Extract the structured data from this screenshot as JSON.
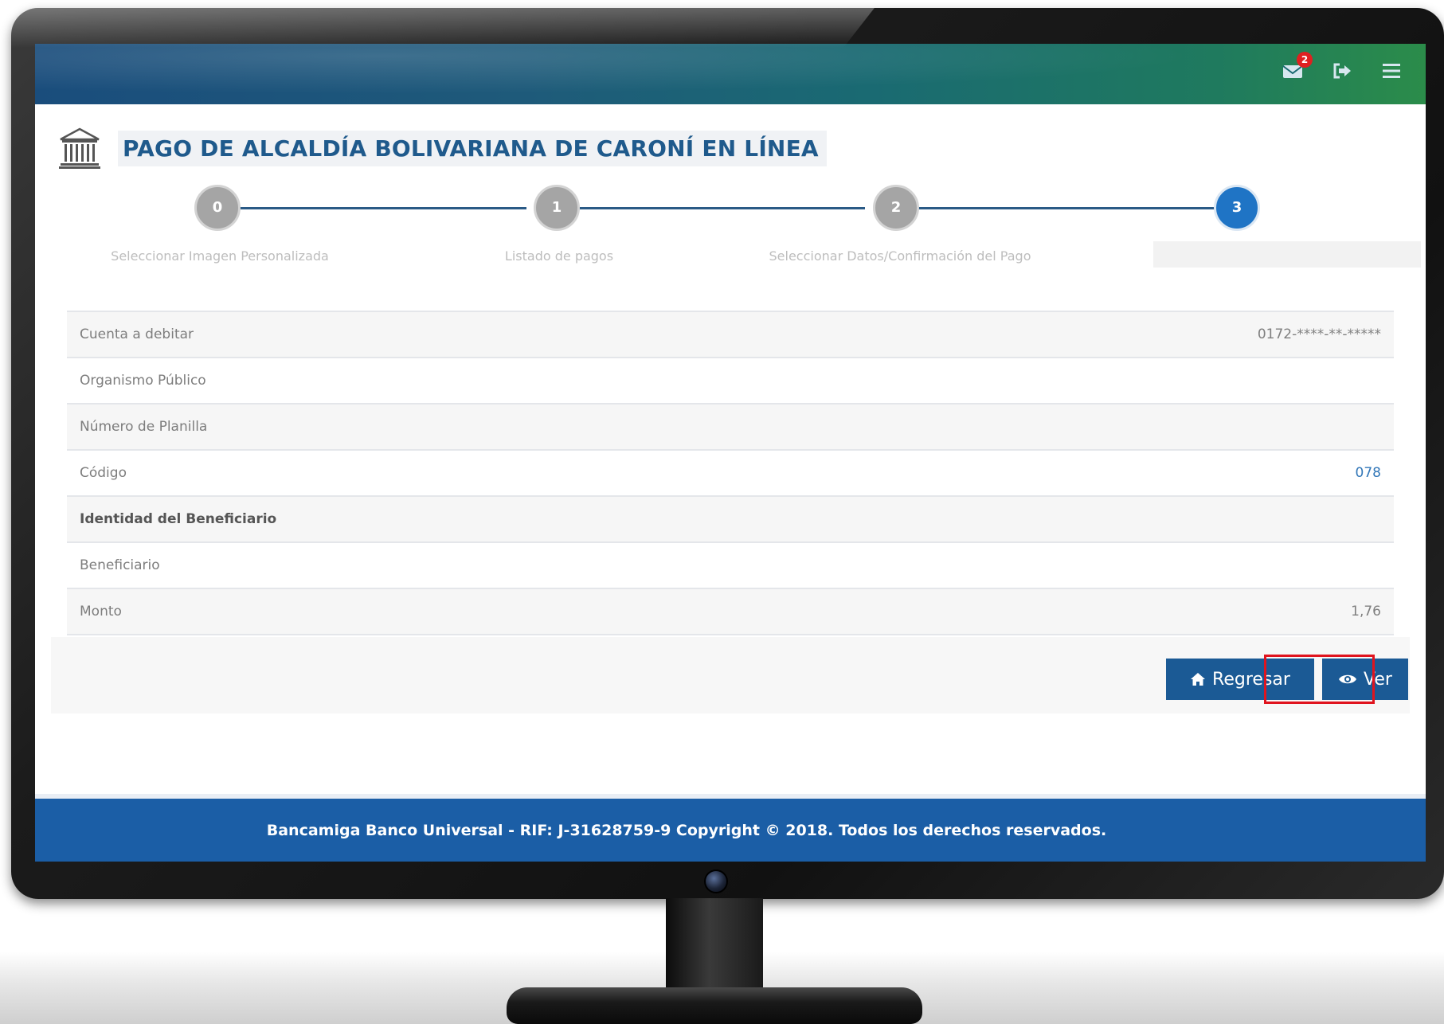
{
  "header": {
    "messages_icon": "envelope-icon",
    "messages_count": "2",
    "logout_icon": "logout-icon",
    "menu_icon": "hamburger-menu-icon"
  },
  "page": {
    "icon": "bank-building-icon",
    "title": "PAGO DE ALCALDÍA BOLIVARIANA DE CARONÍ EN LÍNEA"
  },
  "stepper": {
    "steps": [
      {
        "number": "0",
        "label": "Seleccionar Imagen Personalizada"
      },
      {
        "number": "1",
        "label": "Listado de pagos"
      },
      {
        "number": "2",
        "label": "Seleccionar Datos/Confirmación del Pago"
      },
      {
        "number": "3",
        "label": ""
      }
    ],
    "active_index": 3
  },
  "details": {
    "rows": [
      {
        "label": "Cuenta a debitar",
        "value": "0172-****-**-*****"
      },
      {
        "label": "Organismo Público",
        "value": ""
      },
      {
        "label": "Número de Planilla",
        "value": ""
      },
      {
        "label": "Código",
        "value": "078"
      },
      {
        "label": "Identidad del Beneficiario",
        "value": ""
      },
      {
        "label": "Beneficiario",
        "value": ""
      },
      {
        "label": "Monto",
        "value": "1,76"
      }
    ]
  },
  "actions": {
    "back_label": "Regresar",
    "back_icon": "home-icon",
    "view_label": "Ver",
    "view_icon": "eye-icon"
  },
  "footer": {
    "text": "Bancamiga Banco Universal - RIF: J-31628759-9 Copyright © 2018. Todos los derechos reservados."
  },
  "colors": {
    "primary": "#1b5a95",
    "title": "#1f5a8c",
    "active_step": "#1f74c5",
    "highlight": "#e0141e",
    "footer": "#1b5ea6"
  }
}
